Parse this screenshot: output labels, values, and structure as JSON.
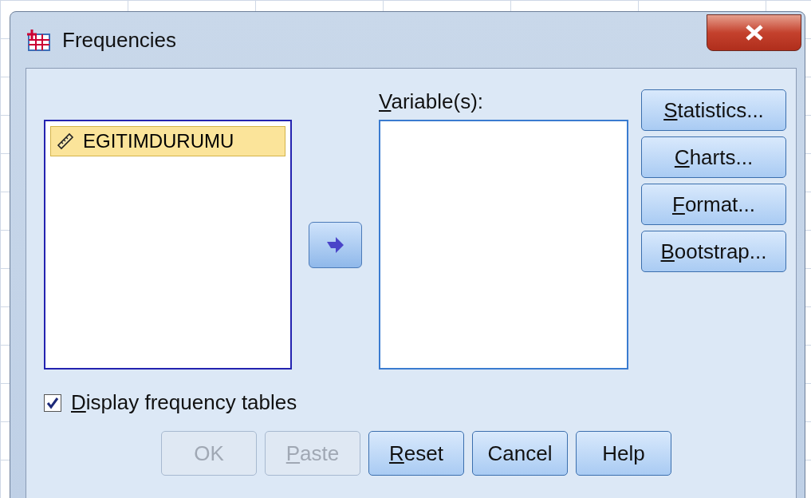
{
  "window": {
    "title": "Frequencies"
  },
  "source_list": {
    "items": [
      {
        "label": "EGITIMDURUMU",
        "selected": true
      }
    ]
  },
  "move_button": {
    "disabled": false
  },
  "target_list": {
    "label": "Variable(s):",
    "first_letter_underlined": true
  },
  "side_buttons": [
    {
      "label": "Statistics...",
      "first_letter_underlined": true
    },
    {
      "label": "Charts...",
      "first_letter_underlined": true
    },
    {
      "label": "Format...",
      "first_letter_underlined": true
    },
    {
      "label": "Bootstrap...",
      "first_letter_underlined": true
    }
  ],
  "display_frequency_tables": {
    "label": "Display frequency tables",
    "first_letter_underlined": true,
    "checked": true
  },
  "buttons": [
    {
      "label": "OK",
      "disabled": true,
      "first_letter_underlined": false
    },
    {
      "label": "Paste",
      "disabled": true,
      "first_letter_underlined": true
    },
    {
      "label": "Reset",
      "disabled": false,
      "first_letter_underlined": true
    },
    {
      "label": "Cancel",
      "disabled": false,
      "first_letter_underlined": false
    },
    {
      "label": "Help",
      "disabled": false,
      "first_letter_underlined": false
    }
  ]
}
